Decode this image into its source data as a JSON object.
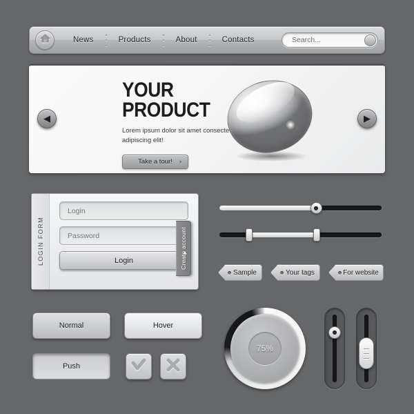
{
  "navbar": {
    "home_icon": "home-icon",
    "items": [
      {
        "label": "News"
      },
      {
        "label": "Products"
      },
      {
        "label": "About"
      },
      {
        "label": "Contacts"
      }
    ],
    "search": {
      "placeholder": "Search...",
      "value": "Search..."
    }
  },
  "banner": {
    "title_line1": "YOUR",
    "title_line2": "PRODUCT",
    "subtitle": "Lorem ipsum dolor sit amet consectetur adipiscing elit!",
    "cta_label": "Take a tour!",
    "cta_arrow": "›",
    "prev_arrow": "◀",
    "next_arrow": "▶"
  },
  "login_form": {
    "section_label": "LOGIN FORM",
    "login_placeholder": "Login",
    "password_placeholder": "Password",
    "submit_label": "Login",
    "create_account_label": "Create account",
    "create_account_chevron": "▼"
  },
  "sliders": {
    "horizontal": [
      {
        "name": "single-slider",
        "value": 60
      },
      {
        "name": "range-slider",
        "low": 18,
        "high": 60
      }
    ],
    "vertical": [
      {
        "name": "vertical-slider-round",
        "value": 72
      },
      {
        "name": "vertical-slider-handle",
        "value": 46
      }
    ]
  },
  "tags": [
    {
      "label": "Sample"
    },
    {
      "label": "Your tags"
    },
    {
      "label": "For website"
    }
  ],
  "buttons": {
    "normal": "Normal",
    "hover": "Hover",
    "push": "Push",
    "check_icon": "check-icon",
    "close_icon": "close-icon"
  },
  "progress": {
    "value_label": "75%",
    "value": 75
  },
  "colors": {
    "page_background": "#666769",
    "panel_light": "#f4f4f5",
    "track_dark": "#18191b",
    "text_dark": "#1d1e20"
  }
}
